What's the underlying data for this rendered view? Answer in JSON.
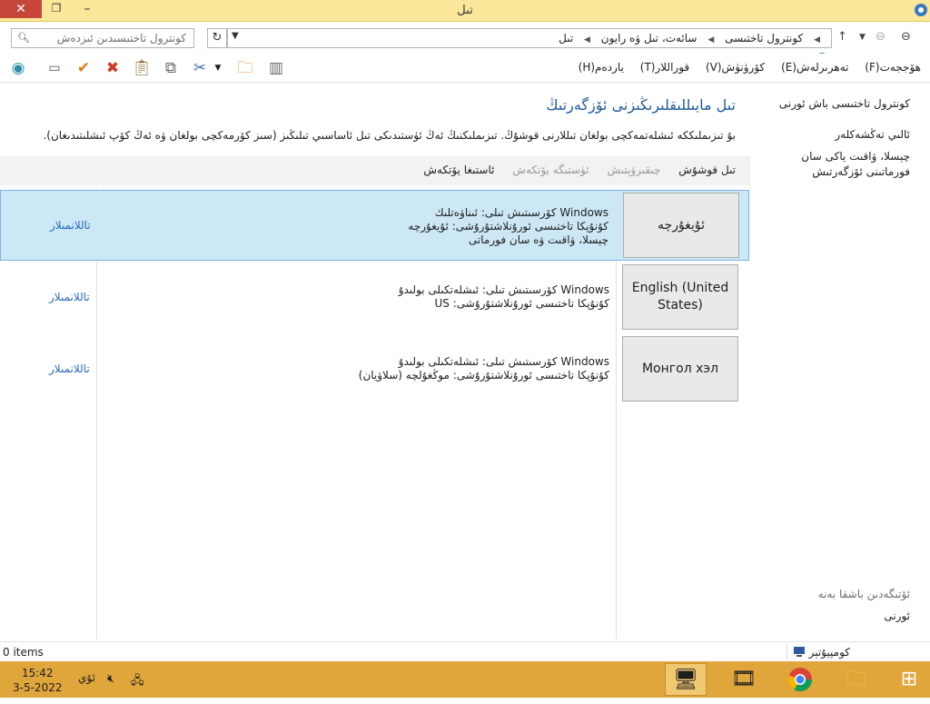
{
  "window": {
    "title": "تىل",
    "close_icon": "close-icon",
    "restore_icon": "restore-icon",
    "minimize_icon": "minimize-icon"
  },
  "address": {
    "search_placeholder": "كونترول تاختىسىدىن ئىزدەش",
    "breadcrumbs": [
      "كونترول تاختىسى",
      "سائەت، تىل ۋە رايون",
      "تىل"
    ]
  },
  "menu": {
    "items": [
      "ھۆججەت(F)",
      "تەھرىرلەش(E)",
      "كۆرۈنۈش(V)",
      "قوراللار(T)",
      "ياردەم(H)"
    ]
  },
  "nav": {
    "home": "كونترول تاختىسى باش ئورنى",
    "advanced": "ئالىي تەڭشەكلەر",
    "date_time": "چېسلا، ۋاقىت ياكى سان فورماتىنى ئۆزگەرتىش",
    "see_also": "ئۆتىگەدىن باشقا بەنە",
    "location": "ئورنى"
  },
  "main": {
    "heading": "تىل مايىللىقلىرىڭىزنى ئۆزگەرتىڭ",
    "description": "بۇ تىزىملىككە ئىشلەتمەكچى بولغان تىللارنى قوشۇڭ. تىزىملىكنىڭ ئەڭ ئۈستىدىكى تىل ئاساسىي تىلىڭىز (سىز كۆرمەكچى بولغان ۋە ئەڭ كۆپ ئىشلىتىدىغان).",
    "commands": {
      "add": "تىل قوشۇش",
      "remove": "چىقىرۋېتىش",
      "move_up": "ئۈستىگە يۆتكەش",
      "move_down": "ئاستىغا يۆتكەش"
    }
  },
  "languages": [
    {
      "name": "ئۇيغۇرچە",
      "line1": "Windows كۆرسىتىش تىلى: ئىناۋەتلىك",
      "line2": "كۇنۇپكا تاختىسى ئورۇنلاشتۇرۇشى: ئۇيغۇرچە",
      "line3": "چېسلا، ۋاقىت ۋە سان فورماتى",
      "options": "تاللانمىلار"
    },
    {
      "name": "English (United States)",
      "line1": "Windows كۆرسىتىش تىلى: ئىشلەتكىلى بولىدۇ",
      "line2": "كۇنۇپكا تاختىسى ئورۇنلاشتۇرۇشى: US",
      "options": "تاللانمىلار"
    },
    {
      "name": "Монгол хэл",
      "line1": "Windows كۆرسىتىش تىلى: ئىشلەتكىلى بولىدۇ",
      "line2": "كۇنۇپكا تاختىسى ئورۇنلاشتۇرۇشى: موڭغۇلچە (سلاۋيان)",
      "options": "تاللانمىلار"
    }
  ],
  "status": {
    "items_count": "0 items",
    "zone": "كومپيۇتېر"
  },
  "taskbar": {
    "time": "15:42",
    "date": "3-5-2022",
    "input_lang": "ئۇي"
  },
  "colors": {
    "titlebar": "#fbe79a",
    "taskbar": "#e0a63c",
    "selection": "#cce8f6",
    "link": "#2a6bb5",
    "heading": "#1e5a9e"
  }
}
